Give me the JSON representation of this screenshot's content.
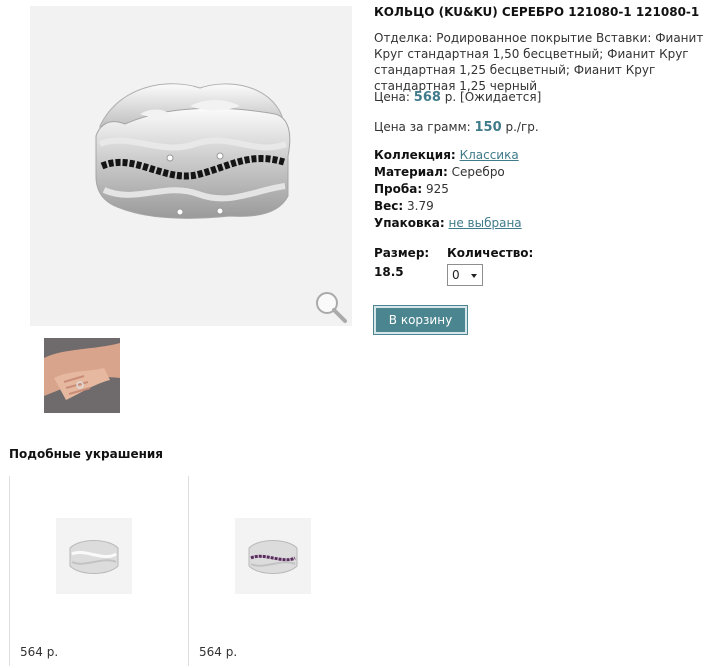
{
  "product": {
    "title": "КОЛЬЦО (KU&KU) СЕРЕБРО 121080-1 121080-1",
    "description": "Отделка: Родированное покрытие Вставки: Фианит Круг стандартная 1,50 бесцветный; Фианит Круг стандартная 1,25 бесцветный; Фианит Круг стандартная 1,25 черный",
    "price_label": "Цена:",
    "price_value": "568",
    "price_unit": "р.",
    "price_status": "[Ожидается]",
    "gram_price_label": "Цена за грамм:",
    "gram_price_value": "150",
    "gram_price_unit": "р./гр.",
    "collection_label": "Коллекция:",
    "collection_value": "Классика",
    "material_label": "Материал:",
    "material_value": "Серебро",
    "probe_label": "Проба:",
    "probe_value": "925",
    "weight_label": "Вес:",
    "weight_value": "3.79",
    "packaging_label": "Упаковка:",
    "packaging_value": "не выбрана",
    "size_label": "Размер:",
    "size_value": "18.5",
    "quantity_label": "Количество:",
    "quantity_value": "0",
    "cart_button": "В корзину"
  },
  "similar": {
    "title": "Подобные украшения",
    "items": [
      {
        "price": "564 р."
      },
      {
        "price": "564 р."
      }
    ]
  },
  "icons": {
    "zoom": "magnifier-icon",
    "dropdown": "chevron-down-icon"
  },
  "colors": {
    "accent": "#3f7b8a",
    "button": "#4a8590"
  }
}
